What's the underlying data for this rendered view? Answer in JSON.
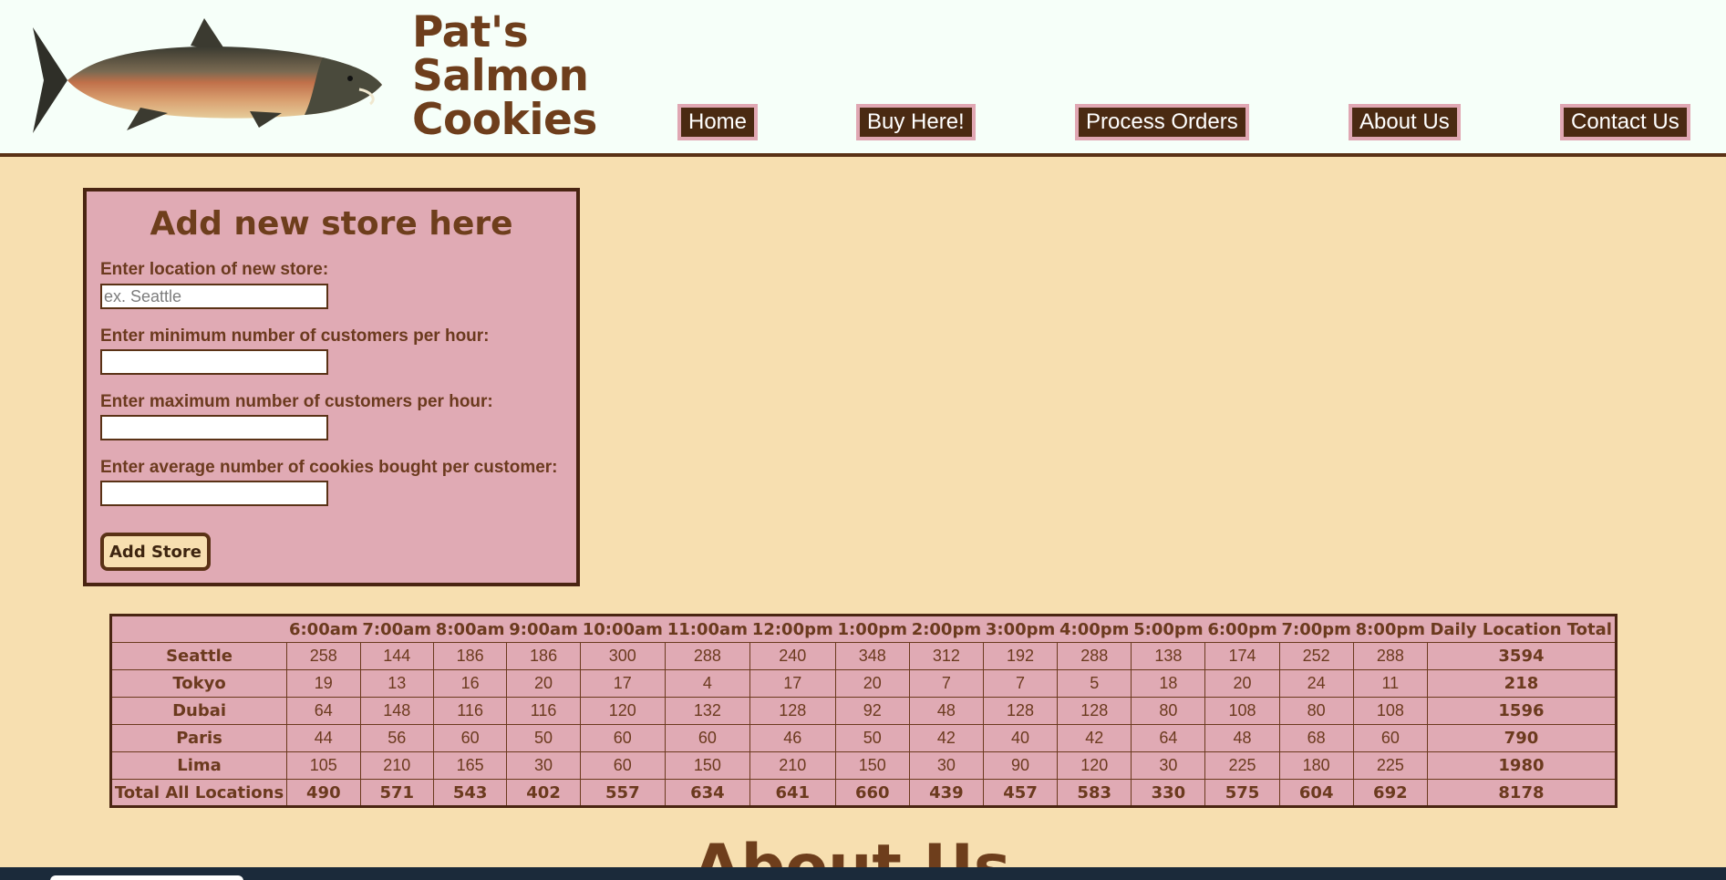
{
  "header": {
    "brand_lines": [
      "Pat's",
      "Salmon",
      "Cookies"
    ],
    "nav": [
      "Home",
      "Buy Here!",
      "Process Orders",
      "About Us",
      "Contact Us"
    ]
  },
  "form": {
    "title": "Add new store here",
    "location_label": "Enter location of new store:",
    "location_placeholder": "ex. Seattle",
    "location_value": "",
    "min_label": "Enter minimum number of customers per hour:",
    "min_value": "",
    "max_label": "Enter maximum number of customers per hour:",
    "max_value": "",
    "avg_label": "Enter average number of cookies bought per customer:",
    "avg_value": "",
    "submit_label": "Add Store"
  },
  "table": {
    "headers": [
      "",
      "6:00am",
      "7:00am",
      "8:00am",
      "9:00am",
      "10:00am",
      "11:00am",
      "12:00pm",
      "1:00pm",
      "2:00pm",
      "3:00pm",
      "4:00pm",
      "5:00pm",
      "6:00pm",
      "7:00pm",
      "8:00pm",
      "Daily Location Total"
    ],
    "rows": [
      {
        "name": "Seattle",
        "values": [
          "258",
          "144",
          "186",
          "186",
          "300",
          "288",
          "240",
          "348",
          "312",
          "192",
          "288",
          "138",
          "174",
          "252",
          "288"
        ],
        "total": "3594"
      },
      {
        "name": "Tokyo",
        "values": [
          "19",
          "13",
          "16",
          "20",
          "17",
          "4",
          "17",
          "20",
          "7",
          "7",
          "5",
          "18",
          "20",
          "24",
          "11"
        ],
        "total": "218"
      },
      {
        "name": "Dubai",
        "values": [
          "64",
          "148",
          "116",
          "116",
          "120",
          "132",
          "128",
          "92",
          "48",
          "128",
          "128",
          "80",
          "108",
          "80",
          "108"
        ],
        "total": "1596"
      },
      {
        "name": "Paris",
        "values": [
          "44",
          "56",
          "60",
          "50",
          "60",
          "60",
          "46",
          "50",
          "42",
          "40",
          "42",
          "64",
          "48",
          "68",
          "60"
        ],
        "total": "790"
      },
      {
        "name": "Lima",
        "values": [
          "105",
          "210",
          "165",
          "30",
          "60",
          "150",
          "210",
          "150",
          "30",
          "90",
          "120",
          "30",
          "225",
          "180",
          "225"
        ],
        "total": "1980"
      }
    ],
    "footer": {
      "name": "Total All Locations",
      "values": [
        "490",
        "571",
        "543",
        "402",
        "557",
        "634",
        "641",
        "660",
        "439",
        "457",
        "583",
        "330",
        "575",
        "604",
        "692"
      ],
      "total": "8178"
    }
  },
  "about_heading": "About Us",
  "colors": {
    "page_bg": "#f7dfb0",
    "header_bg": "#f6fff9",
    "panel_bg": "#e0aab4",
    "brown_text": "#6e3e1c",
    "nav_bg": "#4a2a12",
    "nav_border": "#e0a7b3"
  },
  "icons": {
    "logo": "salmon-fish-image"
  }
}
